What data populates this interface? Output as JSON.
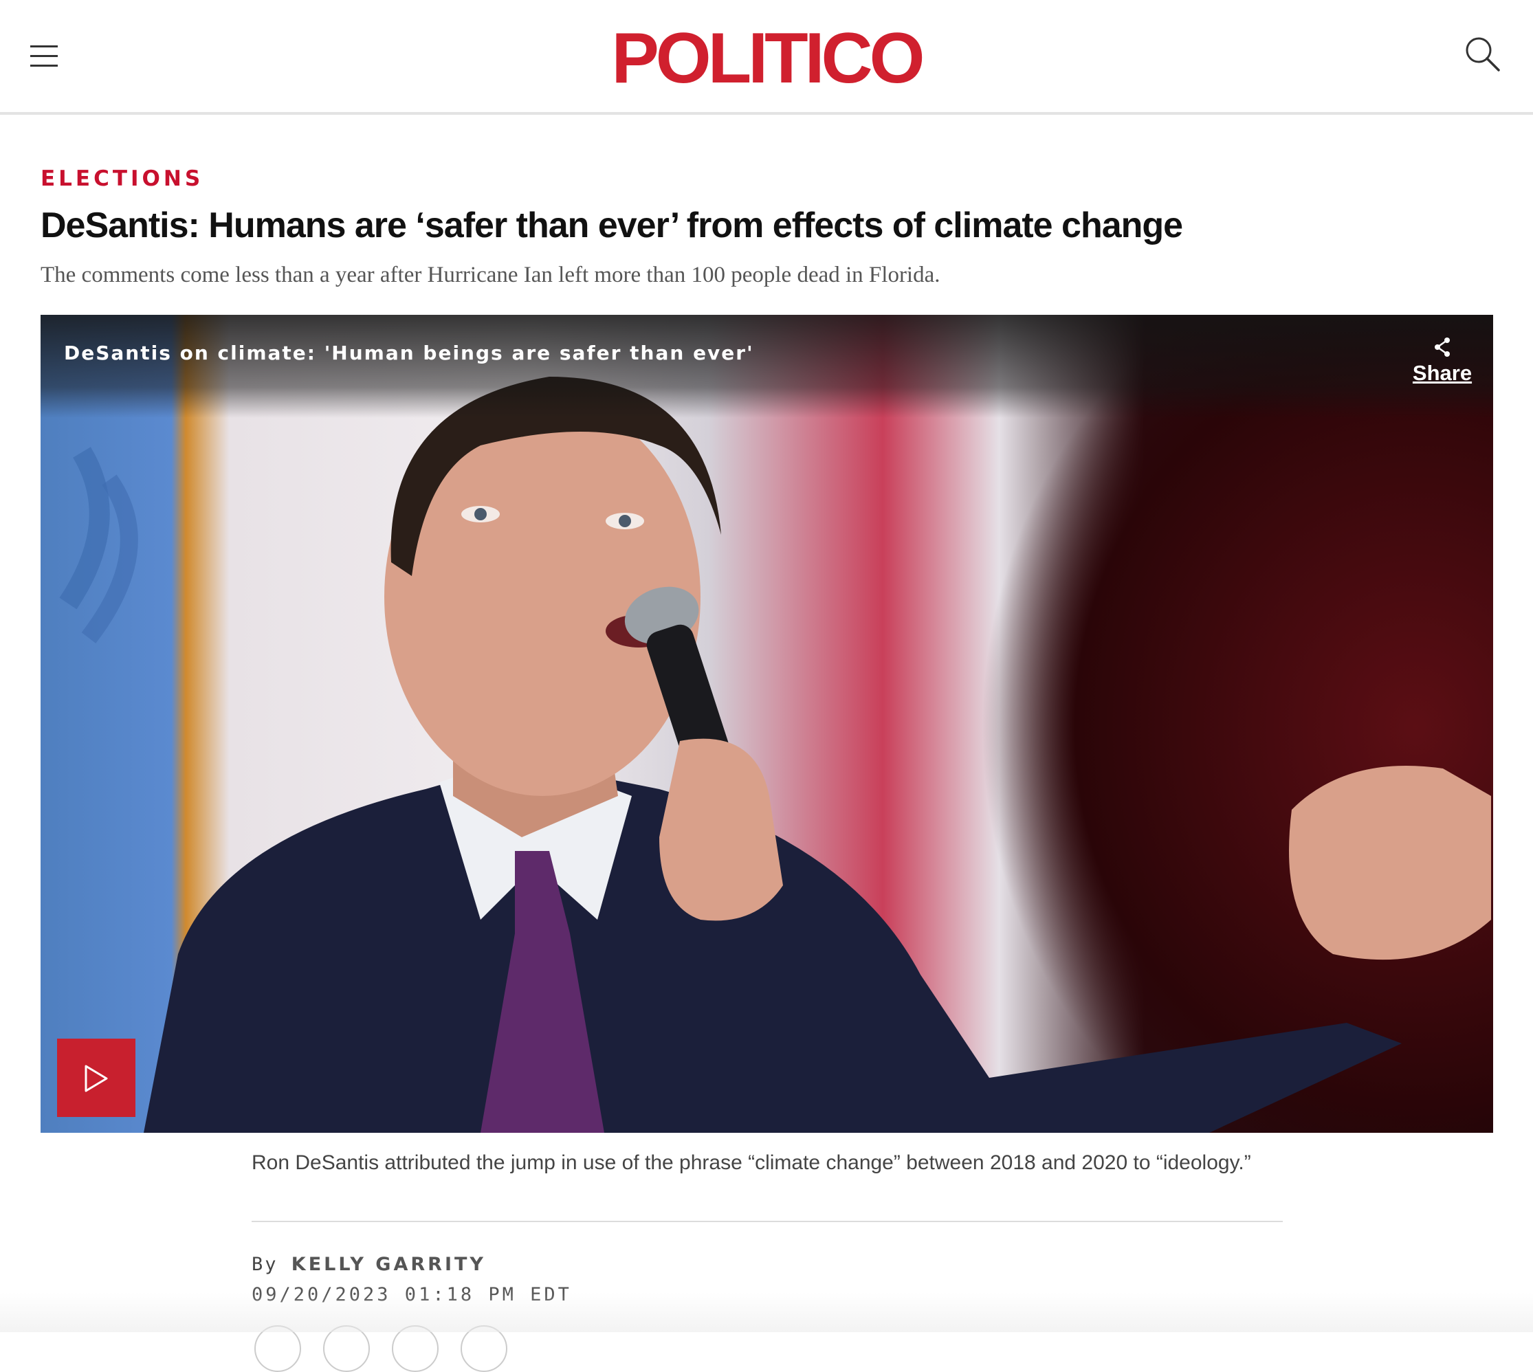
{
  "header": {
    "logo": "POLITICO",
    "menu_icon": "hamburger-menu-icon",
    "search_icon": "search-icon"
  },
  "article": {
    "section": "ELECTIONS",
    "headline": "DeSantis: Humans are ‘safer than ever’ from effects of climate change",
    "dek": "The comments come less than a year after Hurricane Ian left more than 100 people dead in Florida.",
    "video": {
      "title": "DeSantis on climate: 'Human beings are safer than ever'",
      "share_label": "Share",
      "share_icon": "share-icon",
      "play_icon": "play-icon"
    },
    "caption": "Ron DeSantis attributed the jump in use of the phrase “climate change” between 2018 and 2020 to “ideology.”",
    "byline_prefix": "By",
    "author": "KELLY GARRITY",
    "timestamp": "09/20/2023 01:18 PM EDT"
  },
  "colors": {
    "brand_red": "#d0202e",
    "kicker_red": "#c8102e",
    "play_button": "#c8202e"
  }
}
